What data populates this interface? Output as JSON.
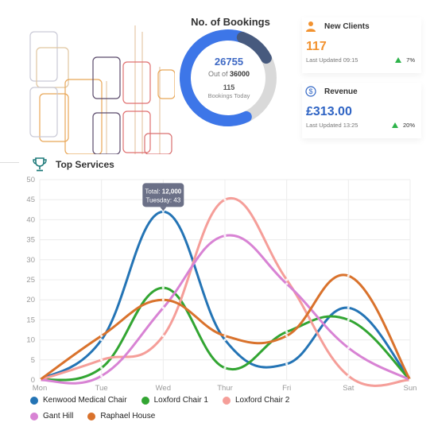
{
  "bookings": {
    "title": "No. of Bookings",
    "total": "26755",
    "out_of_prefix": "Out of",
    "capacity": "36000",
    "today_count": "115",
    "today_label": "Bookings Today",
    "fraction": 0.743,
    "ring_color": "#3d76e8",
    "ring_end_color": "#475a7e",
    "ring_track_color": "#d9d9d9"
  },
  "new_clients": {
    "title": "New Clients",
    "icon": "person-icon",
    "value": "117",
    "value_color": "#f2922f",
    "updated": "Last Updated 09:15",
    "change": "7%"
  },
  "revenue": {
    "title": "Revenue",
    "icon": "dollar-circle-icon",
    "value": "£313.00",
    "value_color": "#2f64c4",
    "updated": "Last Updated 13:25",
    "change": "20%"
  },
  "top_services": {
    "title": "Top Services",
    "icon": "trophy-icon"
  },
  "chart_data": {
    "type": "line",
    "categories": [
      "Mon",
      "Tue",
      "Wed",
      "Thur",
      "Fri",
      "Sat",
      "Sun"
    ],
    "ylim": [
      0,
      50
    ],
    "yticks": [
      0,
      5,
      10,
      15,
      20,
      25,
      30,
      35,
      40,
      45,
      50
    ],
    "grid": true,
    "legend_position": "bottom",
    "series": [
      {
        "name": "Kenwood Medical Chair",
        "color": "#2474b5",
        "values": [
          0,
          10,
          42,
          10,
          4,
          18,
          0
        ]
      },
      {
        "name": "Loxford Chair 1",
        "color": "#32a532",
        "values": [
          0,
          3,
          23,
          3,
          12,
          15,
          0
        ]
      },
      {
        "name": "Loxford Chair 2",
        "color": "#f59e99",
        "values": [
          0,
          5,
          11,
          45,
          25,
          1,
          0
        ]
      },
      {
        "name": "Gant Hill",
        "color": "#d883d4",
        "values": [
          0,
          1,
          18,
          36,
          24,
          8,
          0
        ]
      },
      {
        "name": "Raphael House",
        "color": "#d9722c",
        "values": [
          0,
          11,
          20,
          11,
          11,
          26,
          0
        ]
      }
    ],
    "tooltip": {
      "line1_label": "Total:",
      "line1_value": "12,000",
      "line2": "Tuesday: 43"
    }
  }
}
